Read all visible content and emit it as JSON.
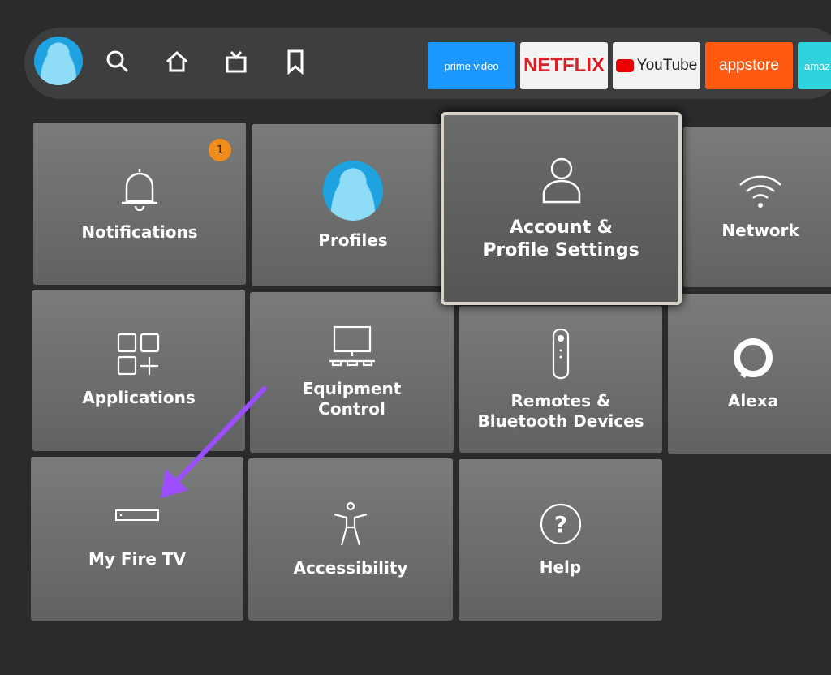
{
  "nav": {
    "icons": [
      "avatar",
      "search-icon",
      "home-icon",
      "live-tv-icon",
      "bookmark-icon"
    ]
  },
  "apps": [
    {
      "label": "prime video",
      "bg": "#1a98ff",
      "fg": "#fff"
    },
    {
      "label": "NETFLIX",
      "bg": "#f3f3f3",
      "fg": "#d81f26"
    },
    {
      "label": "YouTube",
      "bg": "#f3f3f3",
      "fg": "#222"
    },
    {
      "label": "appstore",
      "bg": "#ff5a0f",
      "fg": "#fff"
    },
    {
      "label": "amaz",
      "bg": "#2fd3e0",
      "fg": "#fff"
    }
  ],
  "tiles": {
    "notifications": "Notifications",
    "notifications_badge": "1",
    "profiles": "Profiles",
    "account": "Account & Profile Settings",
    "network": "Network",
    "applications": "Applications",
    "equipment": "Equipment Control",
    "remotes": "Remotes & Bluetooth Devices",
    "alexa": "Alexa",
    "myfiretv": "My Fire TV",
    "accessibility": "Accessibility",
    "help": "Help"
  },
  "colors": {
    "annotation_arrow": "#9b4dff"
  }
}
